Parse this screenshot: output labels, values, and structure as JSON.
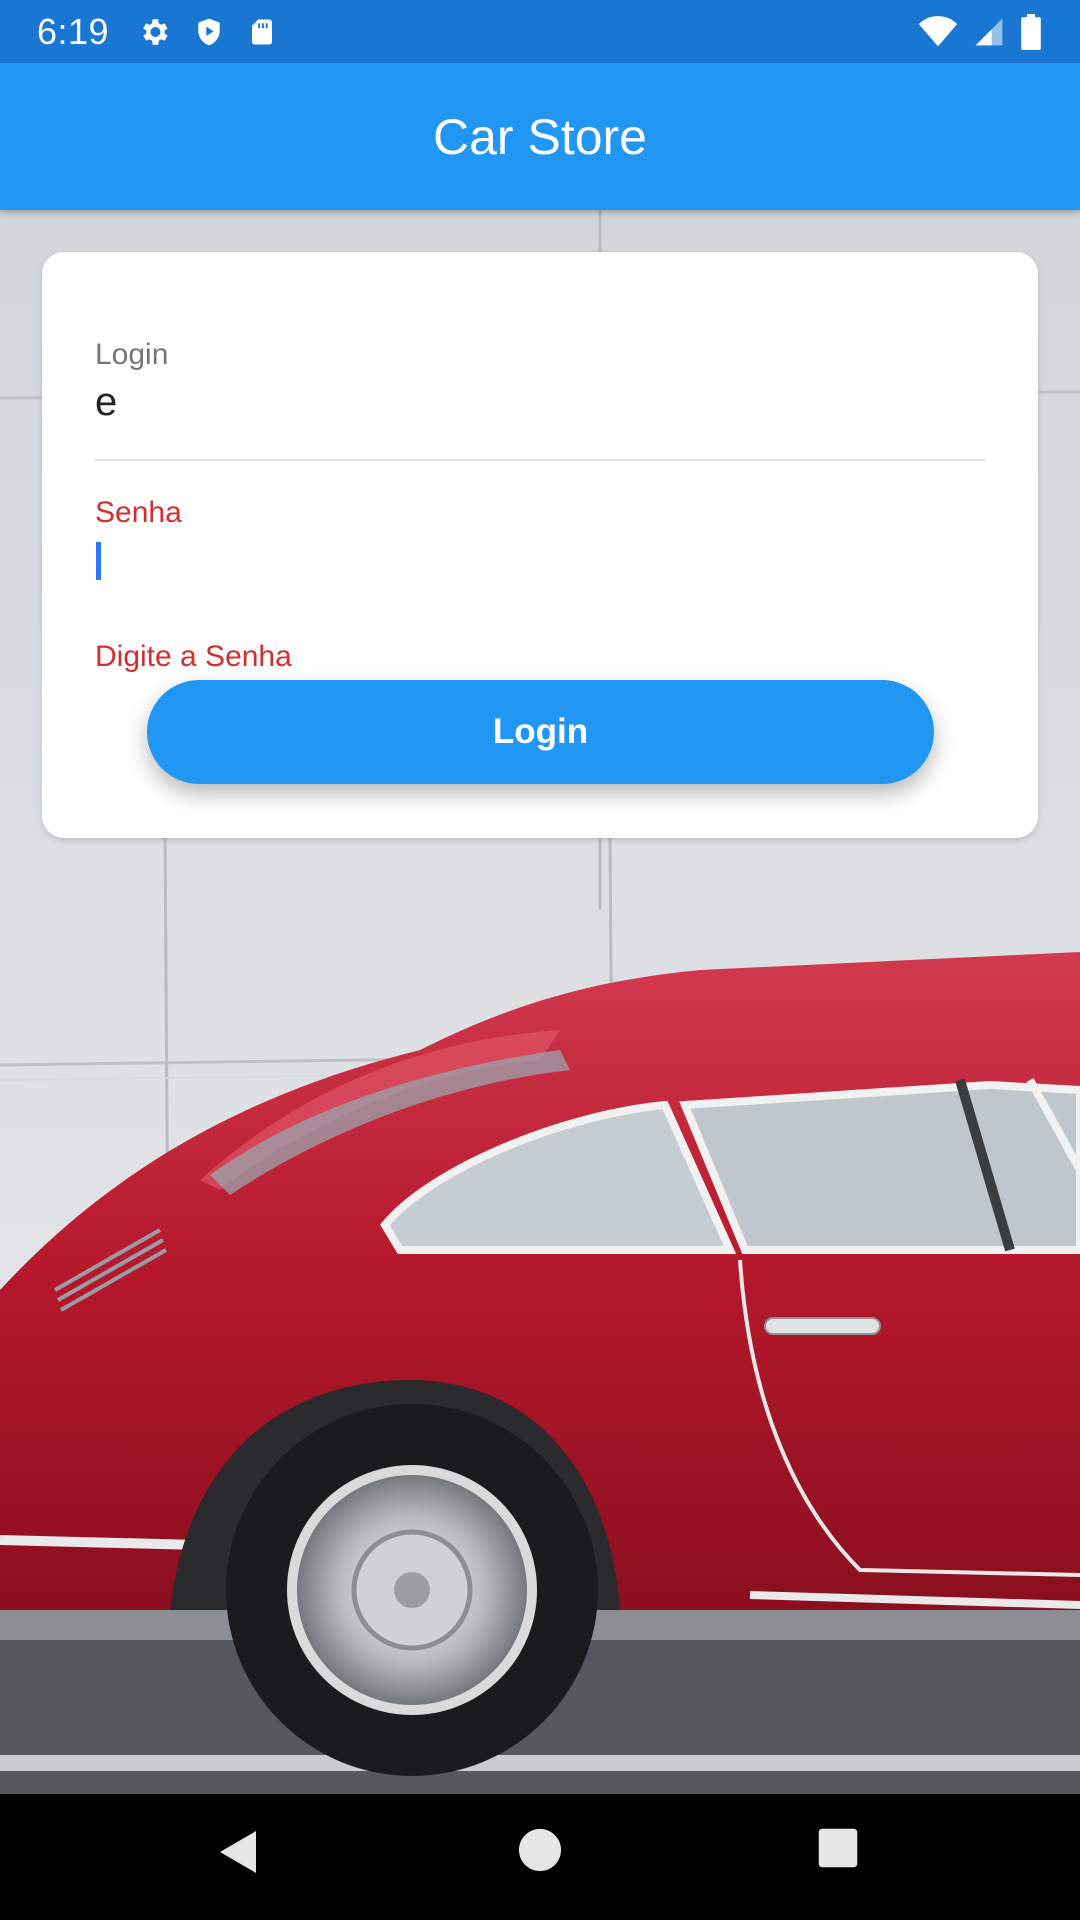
{
  "status_bar": {
    "time": "6:19",
    "left_icons": [
      "gear-icon",
      "play-protect-icon",
      "sd-card-icon"
    ],
    "right_icons": [
      "wifi-icon",
      "cell-signal-icon",
      "battery-icon"
    ]
  },
  "app_bar": {
    "title": "Car Store"
  },
  "form": {
    "login_label": "Login",
    "login_value": "e",
    "senha_label": "Senha",
    "senha_value": "",
    "senha_error": "Digite a Senha",
    "button_label": "Login"
  },
  "nav_bar": {
    "buttons": [
      "back-icon",
      "home-icon",
      "recents-icon"
    ]
  },
  "colors": {
    "status_bar": "#1976d2",
    "app_bar": "#2196f3",
    "button": "#2196f3",
    "error": "#d32f2f",
    "cursor": "#2979ff"
  }
}
